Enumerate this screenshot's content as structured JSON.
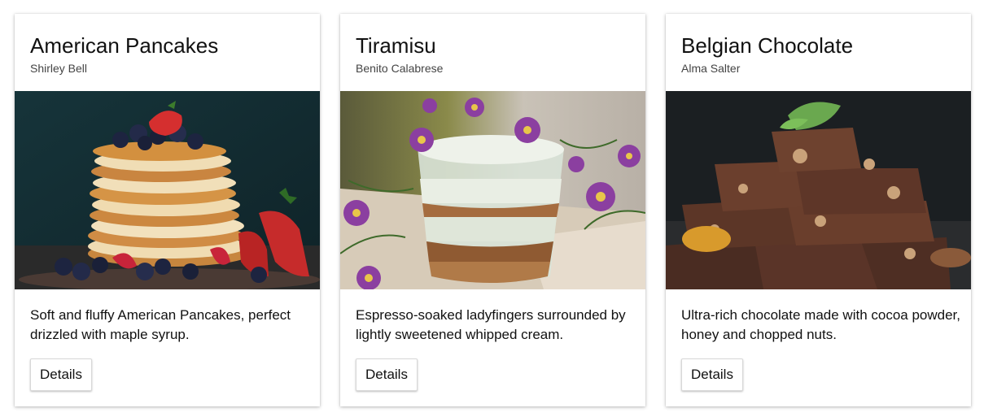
{
  "cards": [
    {
      "title": "American Pancakes",
      "author": "Shirley Bell",
      "description": "Soft and fluffy American Pancakes, perfect drizzled with maple syrup.",
      "button_label": "Details",
      "image_alt": "Stack of pancakes topped with blueberries and strawberries"
    },
    {
      "title": "Tiramisu",
      "author": "Benito Calabrese",
      "description": "Espresso-soaked ladyfingers surrounded by lightly sweetened whipped cream.",
      "button_label": "Details",
      "image_alt": "Tiramisu in a glass with purple flowers"
    },
    {
      "title": "Belgian Chocolate",
      "author": "Alma Salter",
      "description": "Ultra-rich chocolate made with cocoa powder, honey and chopped nuts.",
      "button_label": "Details",
      "image_alt": "Stacked pieces of chocolate with nuts and mint leaf"
    }
  ]
}
